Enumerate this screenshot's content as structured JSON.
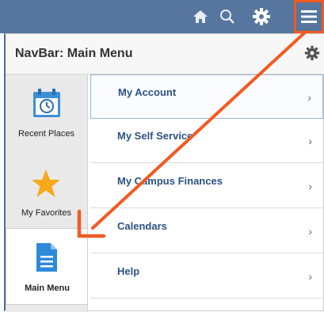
{
  "topbar": {
    "icons": [
      "home-icon",
      "search-icon",
      "gear-icon",
      "hamburger-icon"
    ],
    "highlight_color": "#f25a22"
  },
  "panel": {
    "title": "NavBar: Main Menu"
  },
  "left_nav": {
    "items": [
      {
        "label": "Recent Places",
        "icon": "calendar-clock-icon"
      },
      {
        "label": "My Favorites",
        "icon": "star-icon"
      },
      {
        "label": "Main Menu",
        "icon": "document-icon"
      }
    ]
  },
  "menu": {
    "items": [
      {
        "label": "My Account"
      },
      {
        "label": "My Self Service"
      },
      {
        "label": "My Campus Finances"
      },
      {
        "label": "Calendars"
      },
      {
        "label": "Help"
      }
    ]
  },
  "colors": {
    "topbar": "#56769f",
    "accent": "#f25a22",
    "link": "#2c5282"
  }
}
